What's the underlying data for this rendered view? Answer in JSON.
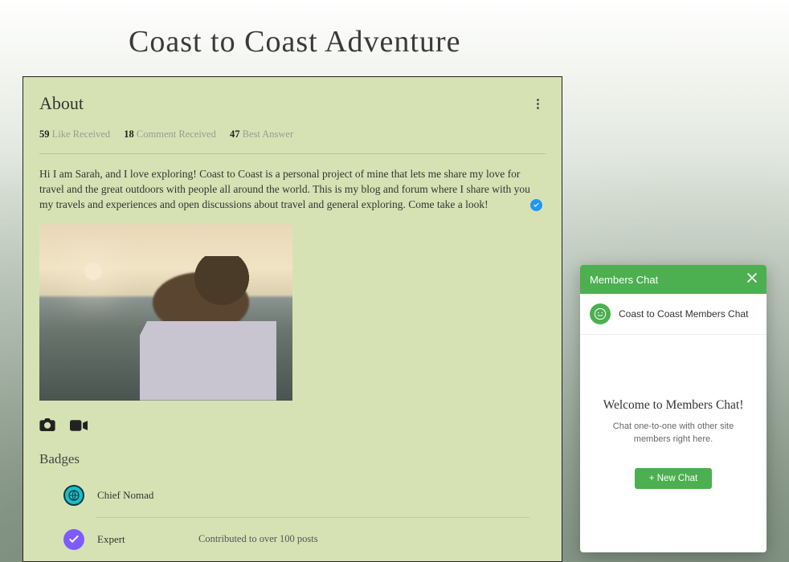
{
  "site": {
    "title": "Coast to Coast Adventure"
  },
  "about": {
    "heading": "About",
    "stats": {
      "likes_count": "59",
      "likes_label": "Like Received",
      "comments_count": "18",
      "comments_label": "Comment Received",
      "best_count": "47",
      "best_label": "Best Answer"
    },
    "bio": "Hi I am Sarah, and I love exploring! Coast to Coast is a personal project of mine that lets me share my love for travel and the great outdoors with people all around the world. This is my blog and forum where I share with you my travels and experiences and open discussions about travel and general exploring. Come take a look!",
    "badges_heading": "Badges",
    "badges": [
      {
        "name": "Chief Nomad",
        "desc": ""
      },
      {
        "name": "Expert",
        "desc": "Contributed to over 100 posts"
      }
    ]
  },
  "chat": {
    "header": "Members Chat",
    "room_name": "Coast to Coast Members Chat",
    "welcome": "Welcome to Members Chat!",
    "sub": "Chat one-to-one with other site members right here.",
    "new_button": "+ New Chat"
  },
  "colors": {
    "accent_green": "#4caf50",
    "card_bg": "#d7e2b4",
    "verify_blue": "#2196f3"
  }
}
